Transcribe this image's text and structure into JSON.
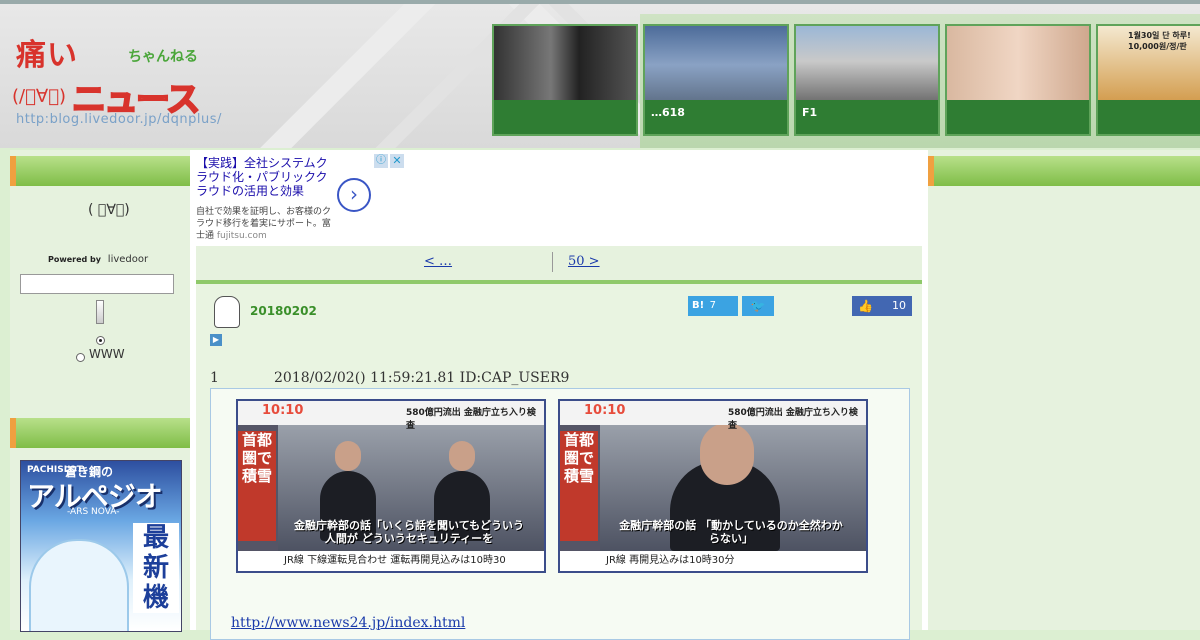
{
  "header": {
    "logo": {
      "main": "痛い",
      "sub": "ちゃんねる",
      "face": "(/ﾟ∀ﾟ)",
      "news": "ニュース",
      "url": "http:blog.livedoor.jp/dqnplus/"
    },
    "thumbnails": [
      {
        "caption": ""
      },
      {
        "caption": "…618"
      },
      {
        "caption": "F1"
      },
      {
        "caption": ""
      },
      {
        "caption": ""
      }
    ],
    "thumb_overlay_text": "1월30일 단 하루! 10,000원/정/판"
  },
  "sidebar": {
    "powered_label": "Powered by",
    "powered_brand": "livedoor",
    "search": {
      "value": "",
      "placeholder": ""
    },
    "radio_www_label": "WWW",
    "banner": {
      "brand": "PACHISLOT",
      "top": "蒼き鋼の",
      "title": "アルペジオ",
      "subtitle": "-ARS NOVA-",
      "side": "最新機"
    }
  },
  "ad": {
    "title": "【実践】全社システムクラウド化・パブリッククラウドの活用と効果",
    "desc": "自社で効果を証明し、お客様のクラウド移行を着実にサポート。富士通",
    "domain": "fujitsu.com"
  },
  "pager": {
    "prev": "<  …",
    "next": "50 >"
  },
  "post": {
    "date": "20180202",
    "hatena_label": "B!",
    "hatena_count": "7",
    "like_count": "10",
    "res_no": "1",
    "res_meta": "2018/02/02() 11:59:21.81 ID:CAP_USER9",
    "images": [
      {
        "clock": "10:10",
        "headline": "580億円流出 金融庁立ち入り検査",
        "caption": "金融庁幹部の話「いくら話を聞いてもどういう人間が どういうセキュリティーを",
        "bottom": "JR線  下線運転見合わせ  運転再開見込みは10時30",
        "side": "首都圏で積雪"
      },
      {
        "clock": "10:10",
        "headline": "580億円流出 金融庁立ち入り検査",
        "caption": "金融庁幹部の話 「動かしているのか全然わからない」",
        "bottom": "JR線  再開見込みは10時30分",
        "side": "首都圏で積雪"
      }
    ],
    "link": "http://www.news24.jp/index.html"
  },
  "colors": {
    "accent_green": "#7fbd47",
    "link_blue": "#1a3aaa",
    "date_green": "#3a8f2a"
  }
}
